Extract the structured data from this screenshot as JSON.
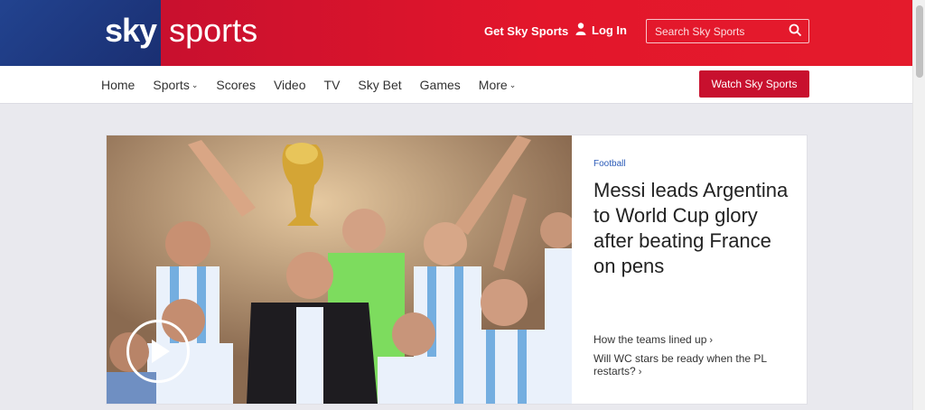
{
  "header": {
    "logo_sky": "sky",
    "logo_sports": "sports",
    "get_sky_sports": "Get Sky Sports",
    "login": "Log In",
    "search_placeholder": "Search Sky Sports",
    "colors": {
      "red": "#e3162b",
      "blue": "#1d3c8d"
    }
  },
  "nav": {
    "items": [
      {
        "label": "Home"
      },
      {
        "label": "Sports",
        "dropdown": true
      },
      {
        "label": "Scores"
      },
      {
        "label": "Video"
      },
      {
        "label": "TV"
      },
      {
        "label": "Sky Bet"
      },
      {
        "label": "Games"
      },
      {
        "label": "More",
        "dropdown": true
      }
    ],
    "watch_button": "Watch Sky Sports"
  },
  "hero": {
    "tag": "Football",
    "headline": "Messi leads Argentina to World Cup glory after beating France on pens",
    "links": [
      {
        "label": "How the teams lined up",
        "arrow": "›"
      },
      {
        "label": "Will WC stars be ready when the PL restarts?",
        "arrow": "›"
      }
    ],
    "media": "video"
  }
}
